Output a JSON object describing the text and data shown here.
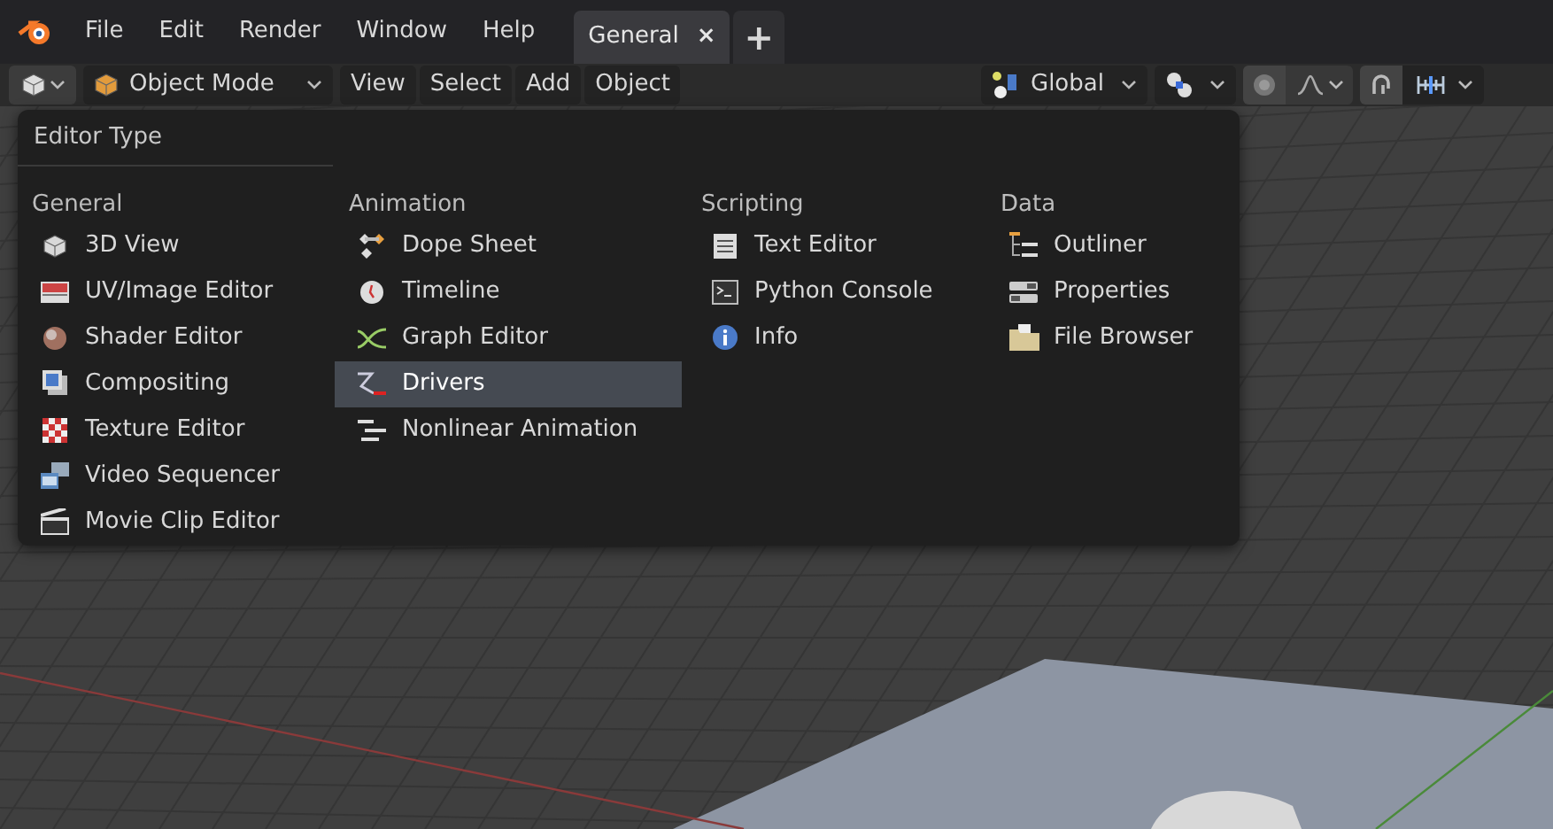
{
  "menu_bar": {
    "items": [
      "File",
      "Edit",
      "Render",
      "Window",
      "Help"
    ]
  },
  "workspace_tabs": [
    {
      "label": "General",
      "selected": true,
      "close": "×"
    }
  ],
  "add_tab": "+",
  "header": {
    "mode": "Object Mode",
    "menus": [
      "View",
      "Select",
      "Add",
      "Object"
    ],
    "orientation": "Global"
  },
  "editor_type_menu": {
    "title": "Editor Type",
    "columns": [
      {
        "heading": "General",
        "items": [
          {
            "label": "3D View",
            "selected": false
          },
          {
            "label": "UV/Image Editor",
            "selected": false
          },
          {
            "label": "Shader Editor",
            "selected": false
          },
          {
            "label": "Compositing",
            "selected": false
          },
          {
            "label": "Texture Editor",
            "selected": false
          },
          {
            "label": "Video Sequencer",
            "selected": false
          },
          {
            "label": "Movie Clip Editor",
            "selected": false
          }
        ]
      },
      {
        "heading": "Animation",
        "items": [
          {
            "label": "Dope Sheet",
            "selected": false
          },
          {
            "label": "Timeline",
            "selected": false
          },
          {
            "label": "Graph Editor",
            "selected": false
          },
          {
            "label": "Drivers",
            "selected": true
          },
          {
            "label": "Nonlinear Animation",
            "selected": false
          }
        ]
      },
      {
        "heading": "Scripting",
        "items": [
          {
            "label": "Text Editor",
            "selected": false
          },
          {
            "label": "Python Console",
            "selected": false
          },
          {
            "label": "Info",
            "selected": false
          }
        ]
      },
      {
        "heading": "Data",
        "items": [
          {
            "label": "Outliner",
            "selected": false
          },
          {
            "label": "Properties",
            "selected": false
          },
          {
            "label": "File Browser",
            "selected": false
          }
        ]
      }
    ]
  }
}
